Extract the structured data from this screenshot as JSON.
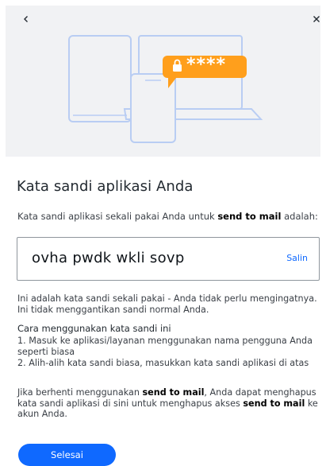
{
  "hero": {
    "masked_password": "****",
    "colors": {
      "background": "#f1f2f4",
      "device_stroke": "#b9cdf3",
      "badge": "#ff9f1c"
    }
  },
  "nav": {
    "back_icon": "chevron-left-icon",
    "close_icon": "close-icon"
  },
  "title": "Kata sandi aplikasi Anda",
  "intro": {
    "prefix": "Kata sandi aplikasi sekali pakai Anda untuk ",
    "app_name": "send to mail",
    "suffix": " adalah:"
  },
  "password": {
    "value": "ovha pwdk wkli sovp",
    "copy_label": "Salin"
  },
  "note": {
    "line1": "Ini adalah kata sandi sekali pakai - Anda tidak perlu mengingatnya.",
    "line2": "Ini tidak menggantikan sandi normal Anda."
  },
  "howto": {
    "title": "Cara menggunakan kata sandi ini",
    "step1_line1": "1. Masuk ke aplikasi/layanan menggunakan nama pengguna Anda",
    "step1_line2": "seperti biasa",
    "step2": "2. Alih-alih kata sandi biasa, masukkan kata sandi aplikasi di atas"
  },
  "revoke": {
    "part1": "Jika berhenti menggunakan ",
    "app_name1": "send to mail",
    "part2": ", Anda dapat menghapus",
    "part3": "kata sandi aplikasi di sini untuk menghapus akses ",
    "app_name2": "send to mail",
    "part4": " ke",
    "part5": "akun Anda."
  },
  "done_button": "Selesai",
  "accent_color": "#0f69ff"
}
